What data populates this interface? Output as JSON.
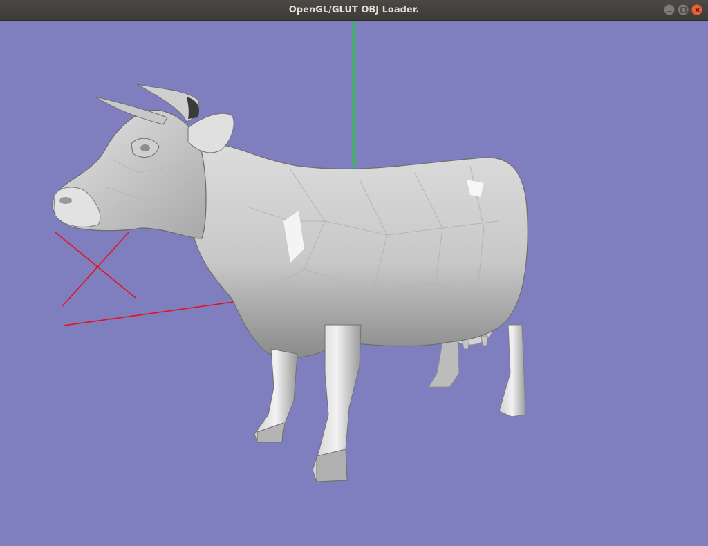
{
  "window": {
    "title": "OpenGL/GLUT OBJ Loader."
  },
  "controls": {
    "minimize": "minimize-icon",
    "maximize": "maximize-icon",
    "close": "close-icon"
  },
  "viewport": {
    "background_color": "#7f7fbf",
    "axis_colors": {
      "x": "#e8101c",
      "y": "#18d038",
      "z": "#e8101c"
    },
    "model_color": "#d8d8d8"
  }
}
